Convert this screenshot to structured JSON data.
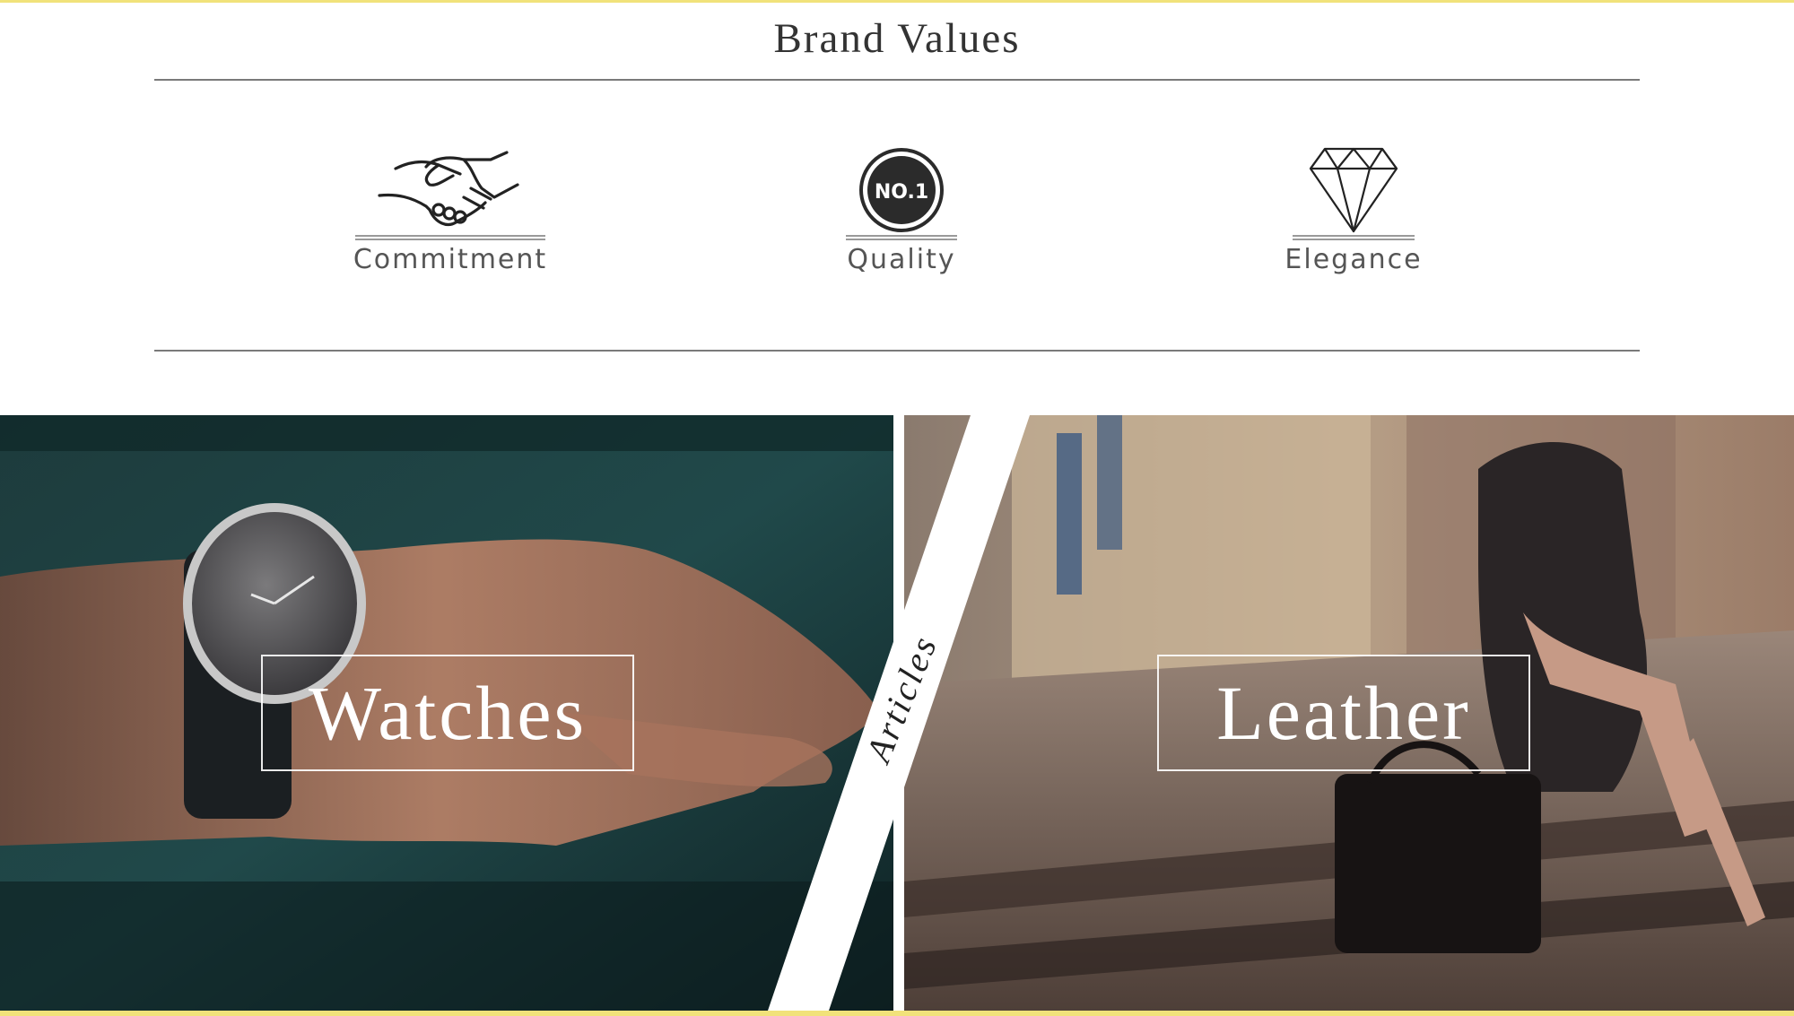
{
  "section": {
    "title": "Brand Values"
  },
  "values": [
    {
      "label": "Commitment",
      "icon": "handshake-icon"
    },
    {
      "label": "Quality",
      "icon": "number-one-badge-icon",
      "badge_text": "NO.1"
    },
    {
      "label": "Elegance",
      "icon": "diamond-icon"
    }
  ],
  "categories": {
    "left": {
      "label": "Watches"
    },
    "divider": {
      "label": "Articles"
    },
    "right": {
      "label": "Leather"
    }
  },
  "colors": {
    "accent": "#f1e27a",
    "text": "#333333",
    "rule": "#7a7a7a"
  }
}
